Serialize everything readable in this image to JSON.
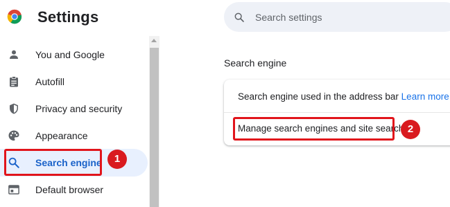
{
  "header": {
    "title": "Settings",
    "logo_icon": "chrome-logo-icon"
  },
  "search": {
    "placeholder": "Search settings",
    "icon": "search-icon"
  },
  "sidebar": {
    "items": [
      {
        "label": "You and Google",
        "icon": "person-icon",
        "active": false
      },
      {
        "label": "Autofill",
        "icon": "clipboard-icon",
        "active": false
      },
      {
        "label": "Privacy and security",
        "icon": "shield-icon",
        "active": false
      },
      {
        "label": "Appearance",
        "icon": "palette-icon",
        "active": false
      },
      {
        "label": "Search engine",
        "icon": "search-icon",
        "active": true
      },
      {
        "label": "Default browser",
        "icon": "browser-window-icon",
        "active": false
      }
    ]
  },
  "main": {
    "section_title": "Search engine",
    "card": {
      "row1_text": "Search engine used in the address bar",
      "row1_link": "Learn more",
      "row2_text": "Manage search engines and site search"
    }
  },
  "annotations": {
    "badge1": "1",
    "badge2": "2",
    "highlight_color": "#e1141b"
  },
  "colors": {
    "accent": "#1a73e8",
    "active_bg": "#e8f0fe",
    "search_bg": "#eef1f7"
  }
}
